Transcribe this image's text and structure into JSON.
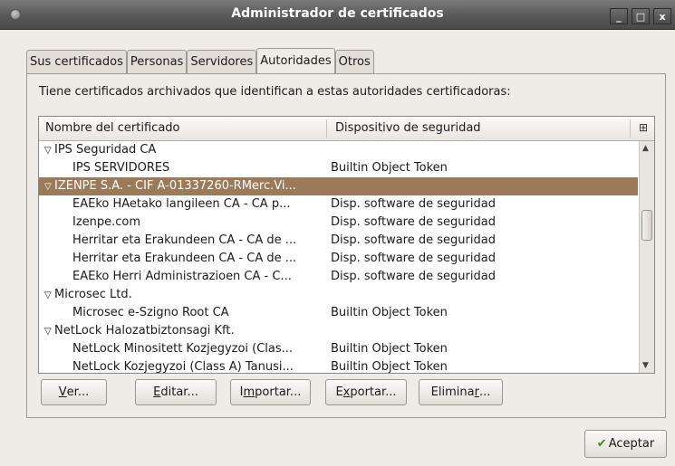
{
  "window": {
    "title": "Administrador de certificados",
    "controls": {
      "minimize": "_",
      "maximize": "□",
      "close": "x"
    }
  },
  "tabs": [
    {
      "label": "Sus certificados",
      "active": false
    },
    {
      "label": "Personas",
      "active": false
    },
    {
      "label": "Servidores",
      "active": false
    },
    {
      "label": "Autoridades",
      "active": true
    },
    {
      "label": "Otros",
      "active": false
    }
  ],
  "description": "Tiene certificados archivados que identifican a estas autoridades certificadoras:",
  "tree": {
    "columns": [
      "Nombre del certificado",
      "Dispositivo de seguridad"
    ],
    "column_picker_icon": "column-picker-icon",
    "rows": [
      {
        "name": "IPS Seguridad CA",
        "device": "",
        "level": 0,
        "expanded": true
      },
      {
        "name": "IPS SERVIDORES",
        "device": "Builtin Object Token",
        "level": 1
      },
      {
        "name": "IZENPE S.A. - CIF A-01337260-RMerc.Vi...",
        "device": "",
        "level": 0,
        "expanded": true,
        "selected": true
      },
      {
        "name": "EAEko HAetako langileen CA - CA p...",
        "device": "Disp. software de seguridad",
        "level": 1
      },
      {
        "name": "Izenpe.com",
        "device": "Disp. software de seguridad",
        "level": 1
      },
      {
        "name": "Herritar eta Erakundeen CA - CA de ...",
        "device": "Disp. software de seguridad",
        "level": 1
      },
      {
        "name": "Herritar eta Erakundeen CA - CA de ...",
        "device": "Disp. software de seguridad",
        "level": 1
      },
      {
        "name": "EAEko Herri Administrazioen CA - C...",
        "device": "Disp. software de seguridad",
        "level": 1
      },
      {
        "name": "Microsec Ltd.",
        "device": "",
        "level": 0,
        "expanded": true
      },
      {
        "name": "Microsec e-Szigno Root CA",
        "device": "Builtin Object Token",
        "level": 1
      },
      {
        "name": "NetLock Halozatbiztonsagi Kft.",
        "device": "",
        "level": 0,
        "expanded": true
      },
      {
        "name": "NetLock Minositett Kozjegyzoi (Clas...",
        "device": "Builtin Object Token",
        "level": 1
      },
      {
        "name": "NetLock Kozjegyzoi (Class A) Tanusi...",
        "device": "Builtin Object Token",
        "level": 1
      }
    ],
    "scroll_fraction": 0.45
  },
  "buttons": {
    "view": {
      "label": "Ver...",
      "mnemonic": "V",
      "rest": "er..."
    },
    "edit": {
      "label": "Editar...",
      "mnemonic": "E",
      "rest": "ditar..."
    },
    "import": {
      "label": "Importar...",
      "pre": "I",
      "mnemonic": "m",
      "rest": "portar..."
    },
    "export": {
      "label": "Exportar...",
      "pre": "E",
      "mnemonic": "x",
      "rest": "portar..."
    },
    "delete": {
      "label": "Eliminar...",
      "pre": "Elimina",
      "mnemonic": "r",
      "rest": "..."
    },
    "accept": {
      "label": "Aceptar",
      "icon": "check-icon"
    }
  }
}
